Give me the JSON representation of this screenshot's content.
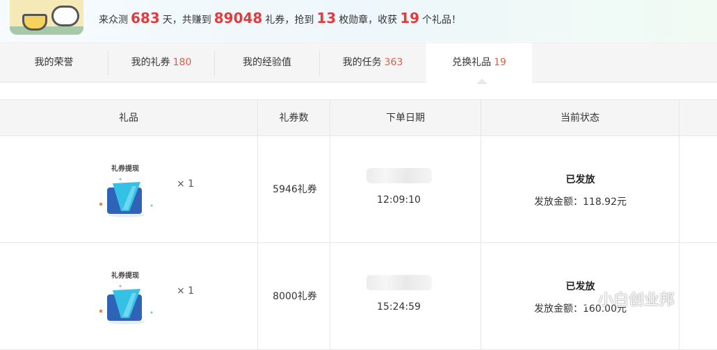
{
  "banner": {
    "prefix": "来众测",
    "days": "683",
    "days_unit": "天，共赚到",
    "vouchers_earned": "89048",
    "vouchers_unit": "礼券，抢到",
    "medals": "13",
    "medals_unit": "枚勋章，收获",
    "gifts": "19",
    "gifts_unit": "个礼品！"
  },
  "tabs": [
    {
      "label": "我的荣誉",
      "count": ""
    },
    {
      "label": "我的礼券",
      "count": "180"
    },
    {
      "label": "我的经验值",
      "count": ""
    },
    {
      "label": "我的任务",
      "count": "363"
    },
    {
      "label": "兑换礼品",
      "count": "19"
    }
  ],
  "table": {
    "headers": [
      "礼品",
      "礼券数",
      "下单日期",
      "当前状态"
    ],
    "rows": [
      {
        "gift_label": "礼券提现",
        "quantity": "× 1",
        "vouchers": "5946礼券",
        "time": "12:09:10",
        "status": "已发放",
        "amount": "发放金额：118.92元"
      },
      {
        "gift_label": "礼券提现",
        "quantity": "× 1",
        "vouchers": "8000礼券",
        "time": "15:24:59",
        "status": "已发放",
        "amount": "发放金额：160.00元"
      }
    ]
  },
  "watermark": {
    "text": "小白创业邦"
  },
  "colors": {
    "accent": "#e23b3b",
    "count": "#e25b45",
    "header_bg": "#f5f5f5",
    "border": "#e6e6e6"
  }
}
